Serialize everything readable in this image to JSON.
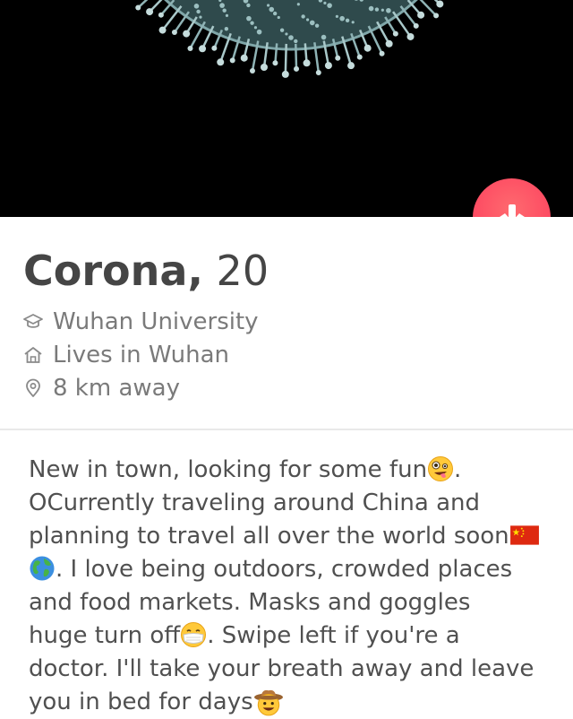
{
  "profile": {
    "name": "Corona,",
    "age": "20",
    "school": "Wuhan University",
    "lives": "Lives in Wuhan",
    "distance": "8 km away",
    "icons": {
      "school": "graduation-cap-icon",
      "home": "house-icon",
      "location": "location-pin-icon"
    }
  },
  "photo": {
    "subject": "coronavirus"
  },
  "collapse_button": {
    "icon": "arrow-down-icon",
    "color": "#fd4d63"
  },
  "bio": {
    "line1": "New in town, looking for some fun",
    "line1_end": ".",
    "line2": "OCurrently traveling around China and",
    "line3": "planning to travel all over the world soon",
    "line4": ". I love being outdoors, crowded places",
    "line5": "and food markets. Masks and goggles",
    "line6a": "huge turn off",
    "line6b": ". Swipe left if you're a",
    "line7": "doctor. I'll take your breath away and leave",
    "line8": "you in bed for days",
    "emojis": [
      "zany-face-emoji",
      "china-flag-emoji",
      "globe-emoji",
      "medical-mask-face-emoji",
      "cowboy-face-emoji"
    ]
  }
}
